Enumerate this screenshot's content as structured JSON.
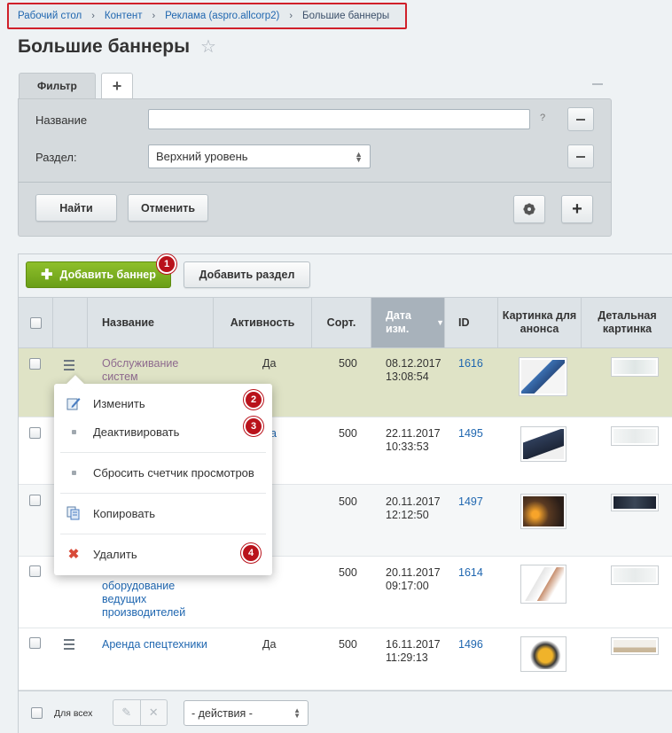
{
  "breadcrumbs": [
    "Рабочий стол",
    "Контент",
    "Реклама (aspro.allcorp2)",
    "Большие баннеры"
  ],
  "page_title": "Большие баннеры",
  "filter": {
    "tabs": [
      "Фильтр",
      "+"
    ],
    "fields": [
      {
        "label": "Название",
        "value": "",
        "hint": "?"
      },
      {
        "label": "Раздел:",
        "value": "Верхний уровень"
      }
    ],
    "find_label": "Найти",
    "cancel_label": "Отменить"
  },
  "toolbar": {
    "add_banner_label": "Добавить баннер",
    "add_section_label": "Добавить раздел"
  },
  "columns": [
    "Название",
    "Активность",
    "Сорт.",
    "Дата изм.",
    "ID",
    "Картинка для анонса",
    "Детальная картинка"
  ],
  "sorted_column": "Дата изм.",
  "rows": [
    {
      "name": "Обслуживание систем",
      "active": "Да",
      "sort": "500",
      "date": "08.12.2017",
      "time": "13:08:54",
      "id": "1616"
    },
    {
      "name": "",
      "active": "",
      "sort": "500",
      "date": "22.11.2017",
      "time": "10:33:53",
      "id": "1495"
    },
    {
      "name": "",
      "active": "",
      "sort": "500",
      "date": "20.11.2017",
      "time": "12:12:50",
      "id": "1497"
    },
    {
      "name_lines": [
        "оборудование",
        "ведущих",
        "производителей"
      ],
      "active": "",
      "sort": "500",
      "date": "20.11.2017",
      "time": "09:17:00",
      "id": "1614"
    },
    {
      "name": "Аренда спецтехники",
      "active": "Да",
      "sort": "500",
      "date": "16.11.2017",
      "time": "11:29:13",
      "id": "1496"
    }
  ],
  "context_menu": [
    "Изменить",
    "Деактивировать",
    "Сбросить счетчик просмотров",
    "Копировать",
    "Удалить"
  ],
  "badges": [
    "1",
    "2",
    "3",
    "4"
  ],
  "footer": {
    "for_all_label": "Для всех",
    "actions_placeholder": "- действия -"
  },
  "colors": {
    "accent_green": "#7aad1f",
    "badge_red": "#b9121b",
    "link": "#2067b0",
    "highlight_row": "#dfe3c6"
  },
  "icons": [
    "star-icon",
    "plus-icon",
    "minus-icon",
    "gear-icon",
    "hamburger-icon",
    "edit-icon",
    "copy-icon",
    "delete-icon",
    "sort-down-icon"
  ]
}
